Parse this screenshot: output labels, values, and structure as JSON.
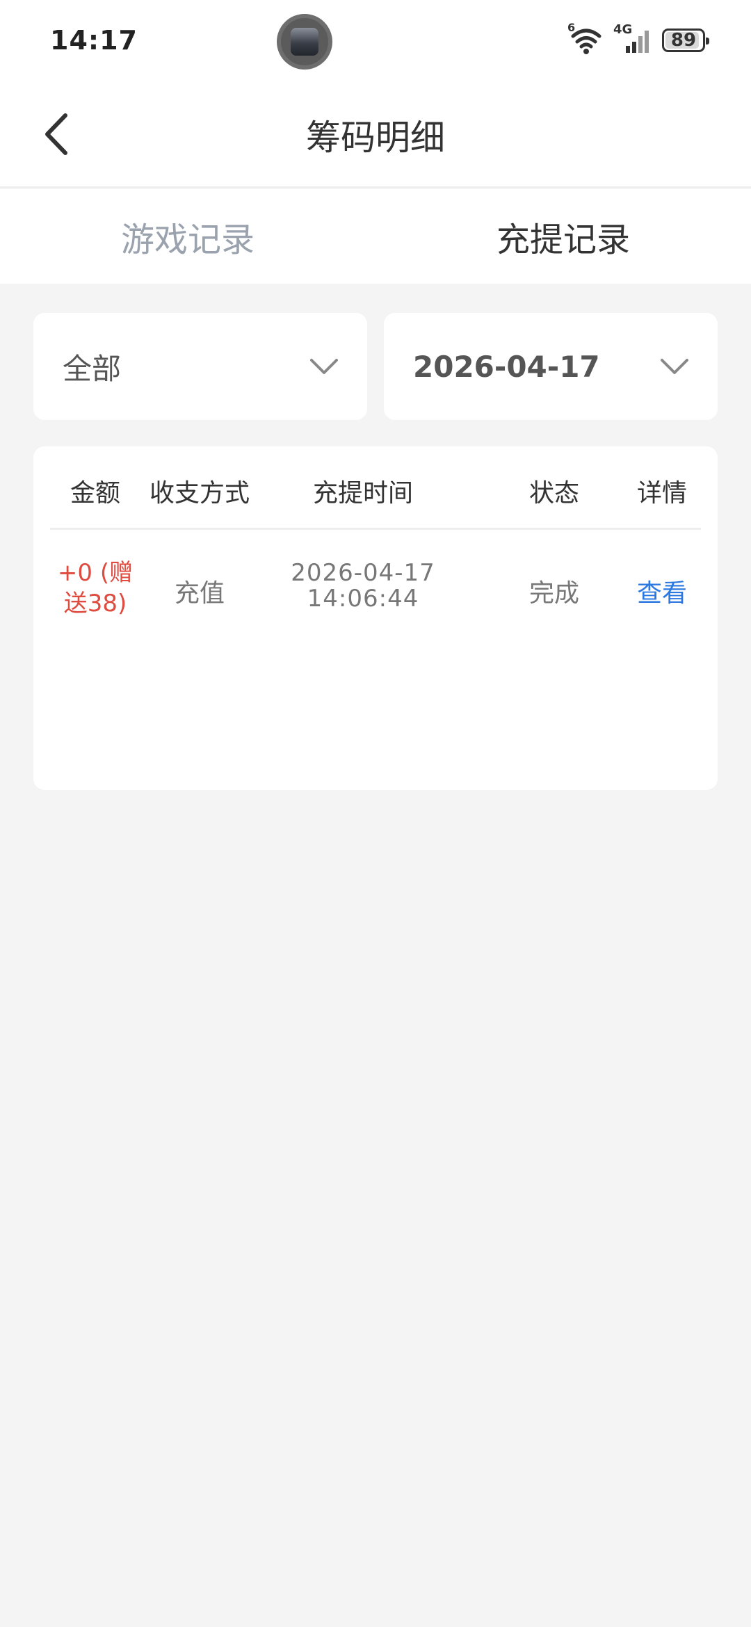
{
  "status_bar": {
    "time": "14:17",
    "battery": "89",
    "network": "4G",
    "wifi_level": "6"
  },
  "nav": {
    "title": "筹码明细",
    "back_icon": "chevron-left-icon"
  },
  "tabs": [
    {
      "label": "游戏记录",
      "active": false
    },
    {
      "label": "充提记录",
      "active": true
    }
  ],
  "filters": {
    "type": {
      "value": "全部",
      "icon": "chevron-down-icon"
    },
    "date": {
      "value": "2026-04-17",
      "icon": "chevron-down-icon"
    }
  },
  "table": {
    "headers": [
      "金额",
      "收支方式",
      "充提时间",
      "状态",
      "详情"
    ],
    "rows": [
      {
        "amount_line1": "+0 (赠",
        "amount_line2": "送38)",
        "method": "充值",
        "date": "2026-04-17",
        "time": "14:06:44",
        "status": "完成",
        "detail": "查看"
      }
    ]
  },
  "colors": {
    "amount": "#e04b3f",
    "link": "#2b79e0",
    "inactive_tab": "#9aa2ae",
    "background": "#f4f4f4"
  }
}
